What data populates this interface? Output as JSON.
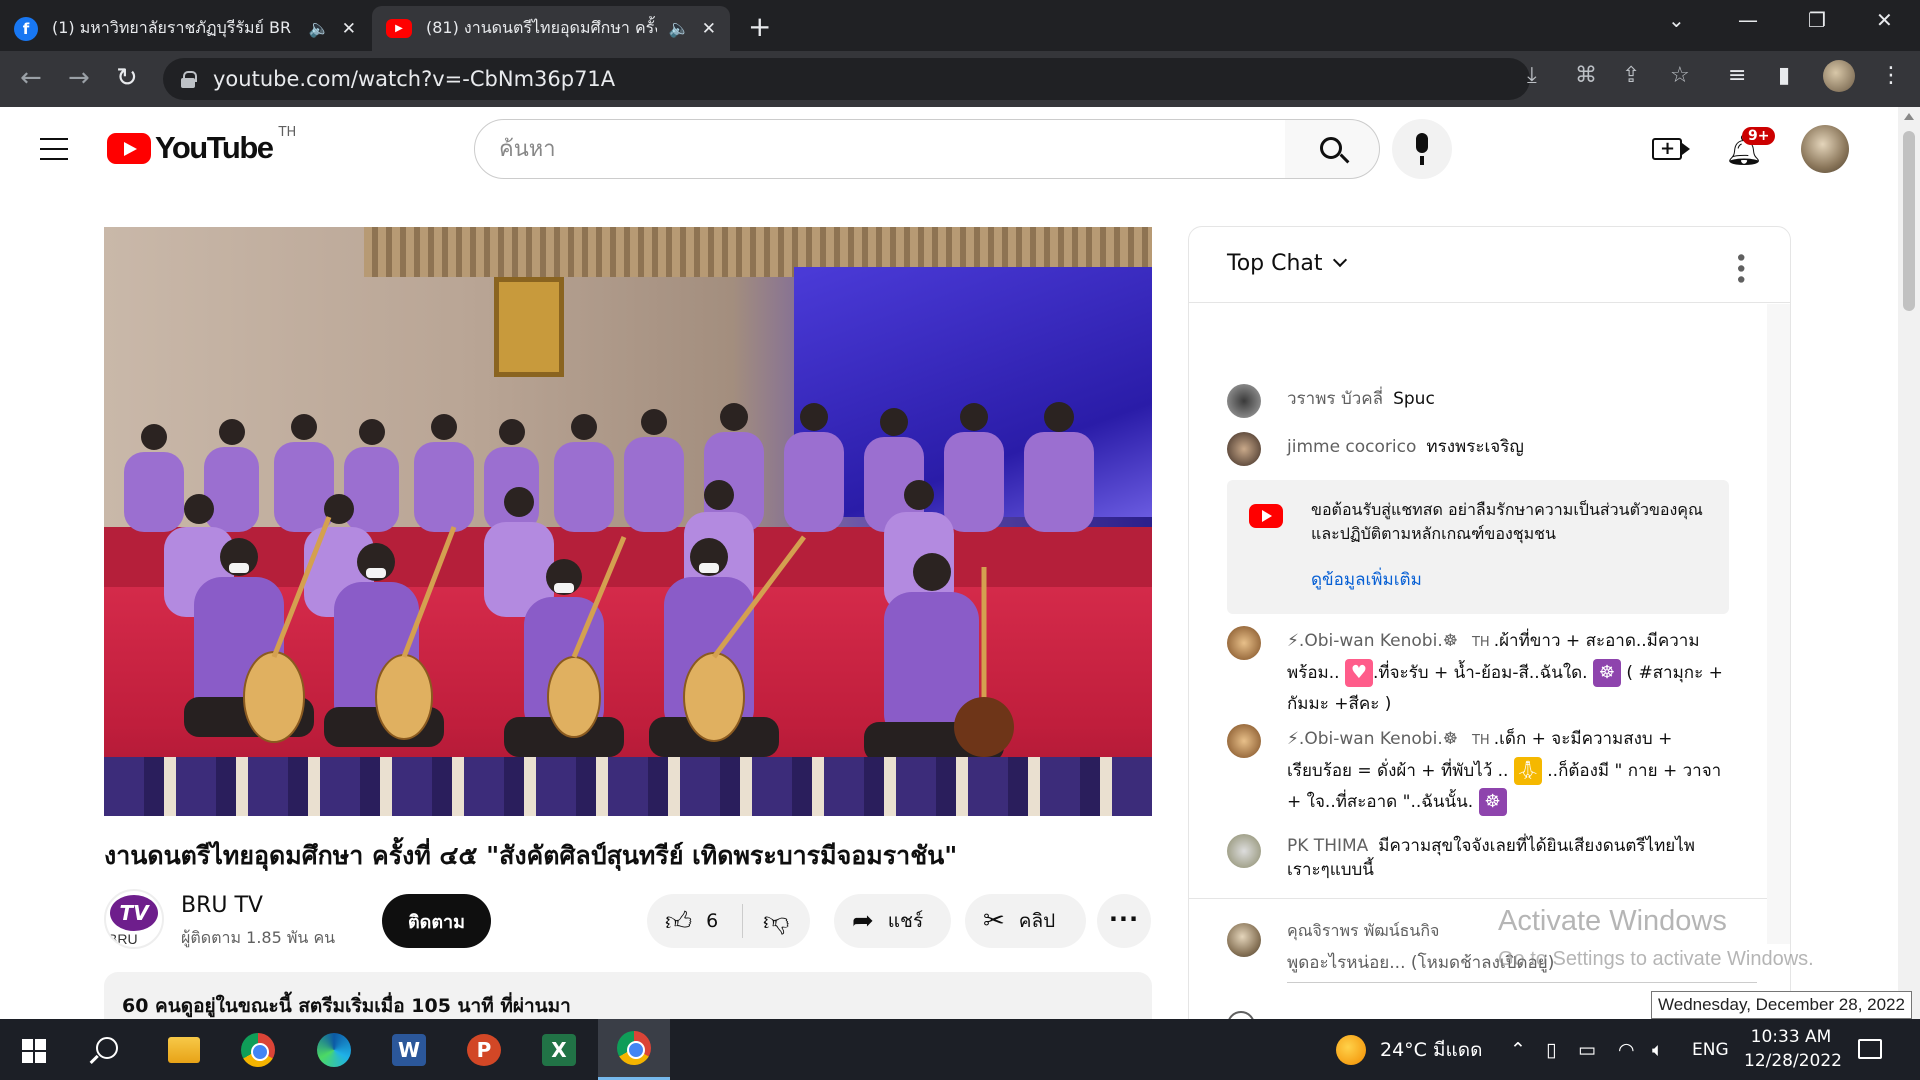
{
  "browser": {
    "tabs": [
      {
        "title": "(1) มหาวิทยาลัยราชภัฏบุรีรัมย์ BR",
        "favicon": "facebook-icon",
        "active": false
      },
      {
        "title": "(81) งานดนตรีไทยอุดมศึกษา ครั้ง",
        "favicon": "youtube-icon",
        "active": true
      }
    ],
    "url": "youtube.com/watch?v=-CbNm36p71A"
  },
  "youtube": {
    "logo_text": "YouTube",
    "country_code": "TH",
    "search_placeholder": "ค้นหา",
    "notification_count": "9+"
  },
  "video": {
    "title": "งานดนตรีไทยอุดมศึกษา ครั้งที่ ๔๕ \"สังคัตศิลป์สุนทรีย์ เทิดพระบารมีจอมราชัน\"",
    "channel_name": "BRU TV",
    "channel_logo_text": "TV",
    "channel_logo_sub": "BRU",
    "subscribers": "ผู้ติดตาม 1.85 พัน คน",
    "subscribe_label": "ติดตาม",
    "like_count": "6",
    "share_label": "แชร์",
    "clip_label": "คลิป",
    "description": "60 คนดูอยู่ในขณะนี้  สตรีมเริ่มเมื่อ 105 นาที ที่ผ่านมา"
  },
  "chat": {
    "header": "Top Chat",
    "messages": [
      {
        "author": "วราพร บัวคลี่",
        "text": "Spuc"
      },
      {
        "author": "jimme cocorico",
        "text": "ทรงพระเจริญ"
      },
      {
        "author": "⚡.Obi-wan Kenobi.☸",
        "badge": "TH",
        "text_parts": [
          ".ผ้าที่ขาว + สะอาด..มีความพร้อม..",
          ".ที่จะรับ + น้ำ-ย้อม-สี..ฉันใด.",
          " ( #สามุกะ + กัมมะ +สีคะ )"
        ]
      },
      {
        "author": "⚡.Obi-wan Kenobi.☸",
        "badge": "TH",
        "text_parts": [
          ".เด็ก + จะมีความสงบ + เรียบร้อย = ดั่งผ้า + ที่พับไว้ ..",
          " ..ก็ต้องมี \" กาย + วาจา + ใจ..ที่สะอาด \"..ฉันนั้น."
        ]
      },
      {
        "author": "PK THIMA",
        "text": "มีความสุขใจจังเลยที่ได้ยินเสียงดนตรีไทยไพเราะๆแบบนี้"
      }
    ],
    "notice_text": "ขอต้อนรับสู่แชทสด อย่าลืมรักษาความเป็นส่วนตัวของคุณและปฏิบัติตามหลักเกณฑ์ของชุมชน",
    "notice_link": "ดูข้อมูลเพิ่มเติม",
    "input_user": "คุณจิราพร พัฒน์ธนกิจ",
    "input_placeholder": "พูดอะไรหน่อย... (โหมดช้าลงเปิดอยู่)"
  },
  "watermark": {
    "line1": "Activate Windows",
    "line2": "Go to Settings to activate Windows."
  },
  "taskbar": {
    "weather": "24°C  มีแดด",
    "language": "ENG",
    "time": "10:33 AM",
    "date": "12/28/2022",
    "tooltip": "Wednesday, December 28, 2022"
  },
  "colors": {
    "youtube_red": "#ff0000",
    "link_blue": "#065fd4",
    "chrome_dark": "#202124",
    "taskbar": "#1c1f26"
  }
}
